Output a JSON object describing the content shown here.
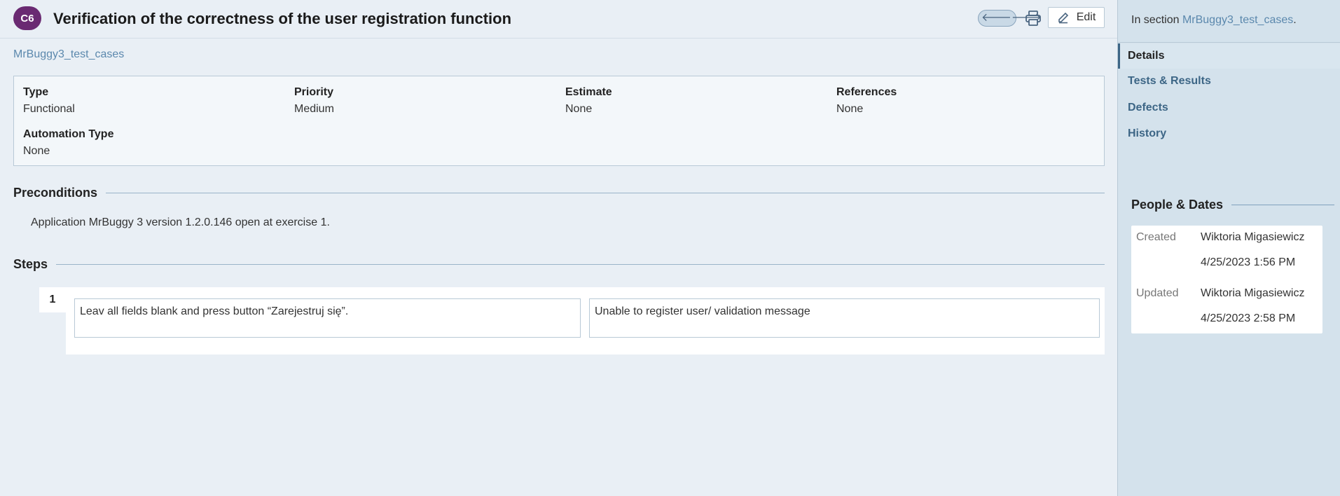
{
  "header": {
    "case_id": "C6",
    "title": "Verification of the correctness of the user registration function",
    "nav_prev": "🡐",
    "nav_next": "🡒",
    "edit_label": "Edit"
  },
  "breadcrumb": {
    "section": "MrBuggy3_test_cases"
  },
  "fields": [
    {
      "label": "Type",
      "value": "Functional"
    },
    {
      "label": "Priority",
      "value": "Medium"
    },
    {
      "label": "Estimate",
      "value": "None"
    },
    {
      "label": "References",
      "value": "None"
    },
    {
      "label": "Automation Type",
      "value": "None"
    }
  ],
  "preconditions": {
    "heading": "Preconditions",
    "text": "Application MrBuggy 3 version 1.2.0.146 open at exercise 1."
  },
  "steps": {
    "heading": "Steps",
    "items": [
      {
        "number": "1",
        "action": "Leav all fields blank and press button “Zarejestruj się”.",
        "expected": "Unable to register user/ validation message"
      }
    ]
  },
  "sidebar": {
    "in_section_prefix": "In section ",
    "in_section_link": "MrBuggy3_test_cases",
    "in_section_suffix": ".",
    "tabs": [
      {
        "label": "Details",
        "active": true
      },
      {
        "label": "Tests & Results",
        "active": false
      },
      {
        "label": "Defects",
        "active": false
      },
      {
        "label": "History",
        "active": false
      }
    ],
    "people_heading": "People & Dates",
    "created_label": "Created",
    "created_by": "Wiktoria Migasiewicz",
    "created_at": "4/25/2023 1:56 PM",
    "updated_label": "Updated",
    "updated_by": "Wiktoria Migasiewicz",
    "updated_at": "4/25/2023 2:58 PM"
  },
  "colors": {
    "badge": "#6a2a72",
    "link": "#5b88ad",
    "sidebar_bg": "#d4e2ec"
  }
}
